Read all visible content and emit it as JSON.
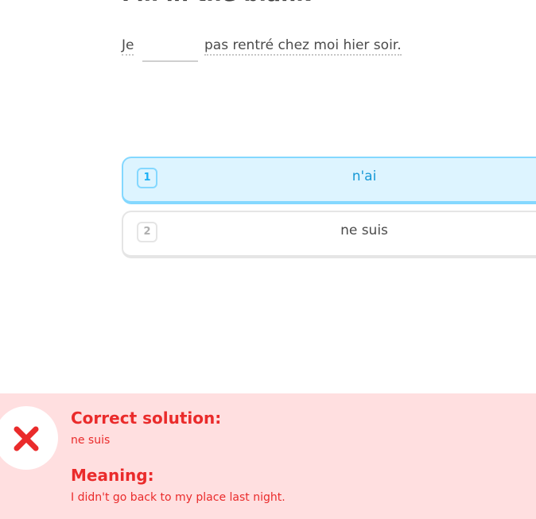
{
  "exercise": {
    "heading": "Fill in the blank",
    "sentence": {
      "before": "Je",
      "after": "pas rentré chez moi hier soir."
    }
  },
  "choices": [
    {
      "number": "1",
      "label": "n'ai",
      "selected": true
    },
    {
      "number": "2",
      "label": "ne suis",
      "selected": false
    }
  ],
  "feedback": {
    "status": "incorrect",
    "status_icon": "x-icon",
    "solution_title": "Correct solution:",
    "solution": "ne suis",
    "meaning_title": "Meaning:",
    "meaning": "I didn't go back to my place last night.",
    "colors": {
      "background": "#ffdfe0",
      "text": "#ea2b2b",
      "selected_bg": "#ddf4ff",
      "selected_border": "#84d8ff"
    }
  }
}
